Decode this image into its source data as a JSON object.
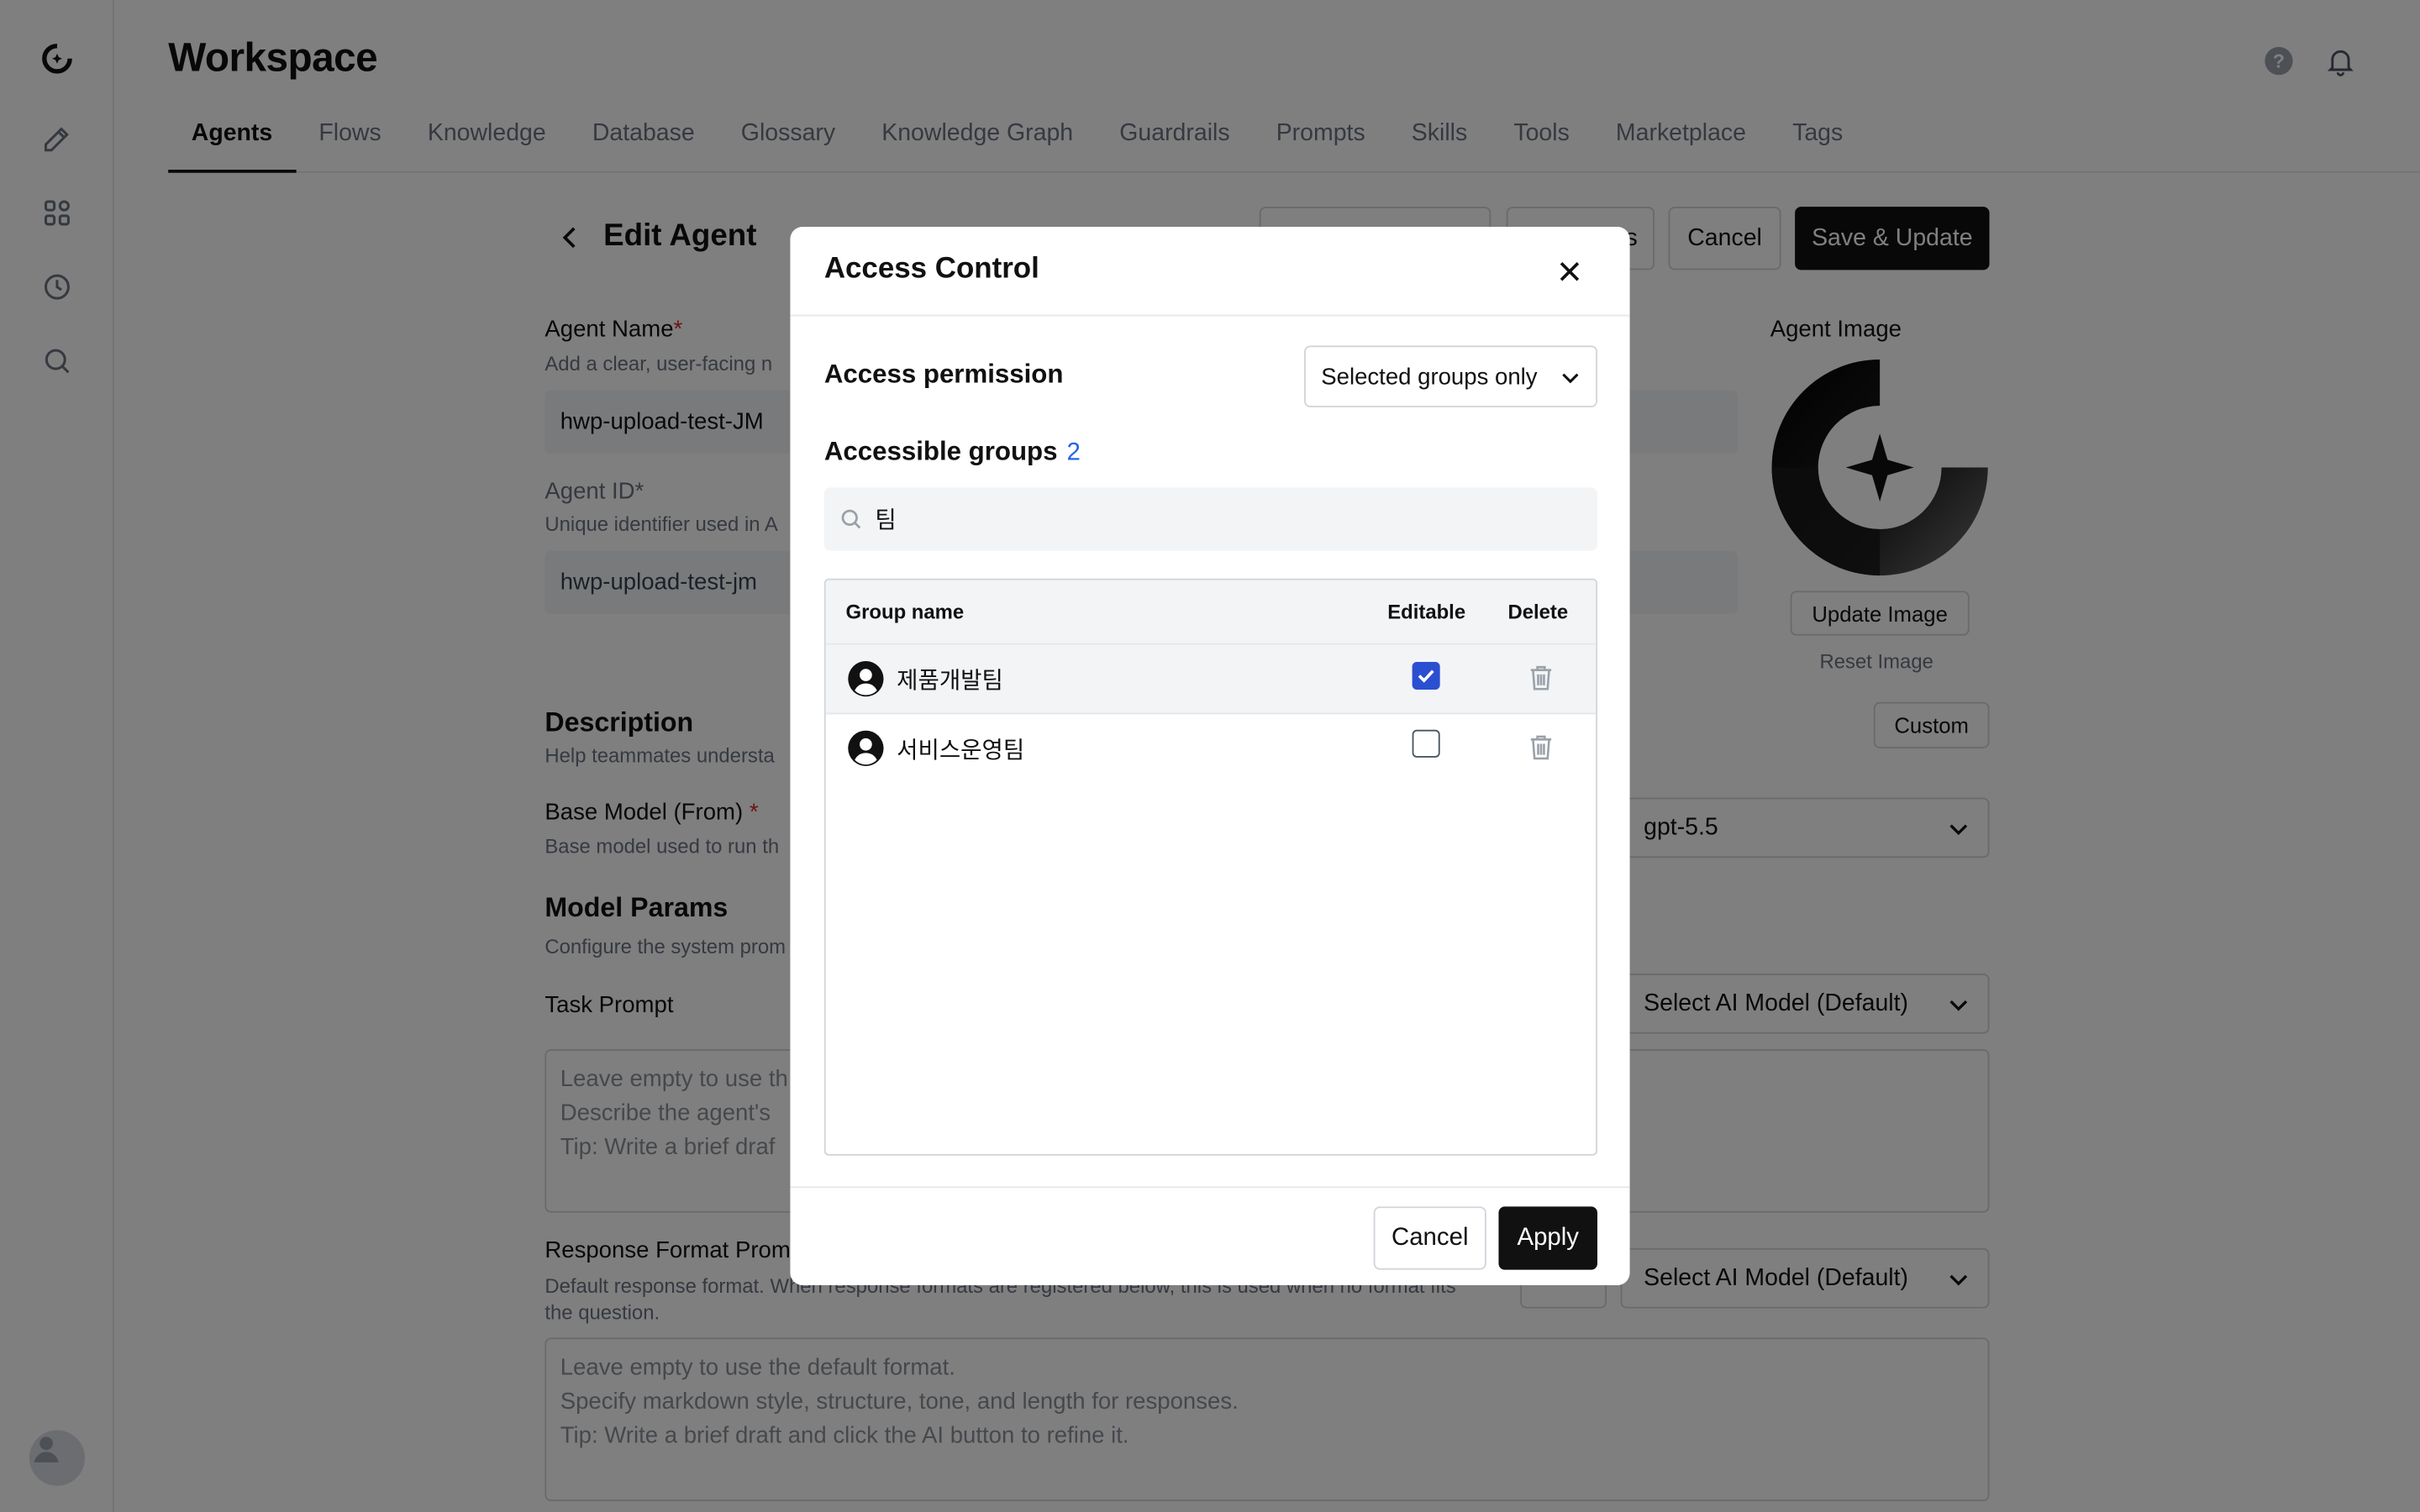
{
  "app": {
    "title": "Workspace",
    "tabs": [
      "Agents",
      "Flows",
      "Knowledge",
      "Database",
      "Glossary",
      "Knowledge Graph",
      "Guardrails",
      "Prompts",
      "Skills",
      "Tools",
      "Marketplace",
      "Tags"
    ],
    "active_tab": "Agents"
  },
  "rail": {
    "icons": [
      "logo-icon",
      "edit-icon",
      "apps-icon",
      "history-icon",
      "search-icon"
    ]
  },
  "editor": {
    "title": "Edit Agent",
    "cancel_label": "Cancel",
    "save_label": "Save & Update",
    "partial_button_text": "s",
    "agent_name_label": "Agent Name",
    "agent_name_hint": "Add a clear, user-facing n",
    "agent_name_value": "hwp-upload-test-JM",
    "agent_id_label": "Agent ID",
    "agent_id_hint": "Unique identifier used in A",
    "agent_id_value": "hwp-upload-test-jm",
    "required_mark": "*",
    "agent_image_label": "Agent Image",
    "update_image_label": "Update Image",
    "reset_image_label": "Reset Image",
    "description_label": "Description",
    "description_hint": "Help teammates understa",
    "custom_label": "Custom",
    "base_model_label": "Base Model (From)",
    "base_model_hint": "Base model used to run th",
    "base_model_value": "gpt-5.5",
    "model_params_label": "Model Params",
    "model_params_hint": "Configure the system prom",
    "task_prompt_label": "Task Prompt",
    "task_prompt_model": "Select AI Model (Default)",
    "task_prompt_placeholder": "Leave empty to use th\nDescribe the agent's\nTip: Write a brief draf",
    "response_format_label": "Response Format Promp",
    "response_format_hint": "Default response format. When response formats are registered below, this is used when no format fits\nthe question.",
    "response_format_model": "Select AI Model (Default)",
    "response_format_placeholder": "Leave empty to use the default format.\nSpecify markdown style, structure, tone, and length for responses.\nTip: Write a brief draft and click the AI button to refine it."
  },
  "modal": {
    "title": "Access Control",
    "permission_label": "Access permission",
    "permission_value": "Selected groups only",
    "groups_label": "Accessible groups",
    "groups_count": "2",
    "search_value": "팀",
    "columns": {
      "name": "Group name",
      "editable": "Editable",
      "delete": "Delete"
    },
    "rows": [
      {
        "name": "제품개발팀",
        "editable": true
      },
      {
        "name": "서비스운영팀",
        "editable": false
      }
    ],
    "cancel_label": "Cancel",
    "apply_label": "Apply"
  },
  "colors": {
    "accent_blue": "#2563eb",
    "checkbox_blue": "#2b4fd1",
    "primary_dark": "#111111",
    "required_red": "#dc2626",
    "overlay": "rgba(0,0,0,0.5)"
  }
}
